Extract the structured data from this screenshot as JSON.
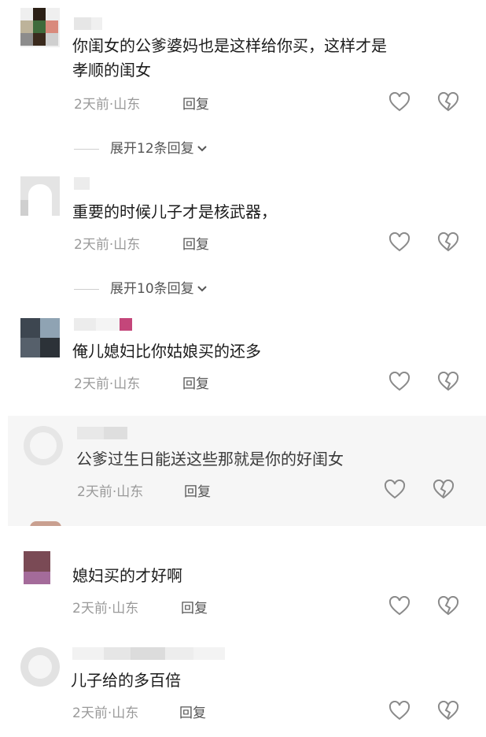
{
  "comments": [
    {
      "text": "你闺女的公爹婆妈也是这样给你买，这样才是\n孝顺的闺女",
      "time": "2天前",
      "dot": "·",
      "location": "山东",
      "reply": "回复"
    },
    {
      "text": "重要的时候儿子才是核武器，",
      "time": "2天前",
      "dot": "·",
      "location": "山东",
      "reply": "回复"
    },
    {
      "text": "俺儿媳妇比你姑娘买的还多",
      "time": "2天前",
      "dot": "·",
      "location": "山东",
      "reply": "回复"
    },
    {
      "text": "公爹过生日能送这些那就是你的好闺女",
      "time": "2天前",
      "dot": "·",
      "location": "山东",
      "reply": "回复"
    },
    {
      "text": "媳妇买的才好啊",
      "time": "2天前",
      "dot": "·",
      "location": "山东",
      "reply": "回复"
    },
    {
      "text": "儿子给的多百倍",
      "time": "2天前",
      "dot": "·",
      "location": "山东",
      "reply": "回复"
    }
  ],
  "expand": [
    {
      "label": "展开12条回复"
    },
    {
      "label": "展开10条回复"
    }
  ],
  "icons": {
    "like": "heart-outline-icon",
    "dislike": "broken-heart-icon",
    "expand": "chevron-down-icon"
  },
  "colors": {
    "text": "#1c1c1c",
    "meta": "#9a9a9a",
    "icon": "#8a8a8a",
    "pink_tag": "#c4467a"
  }
}
